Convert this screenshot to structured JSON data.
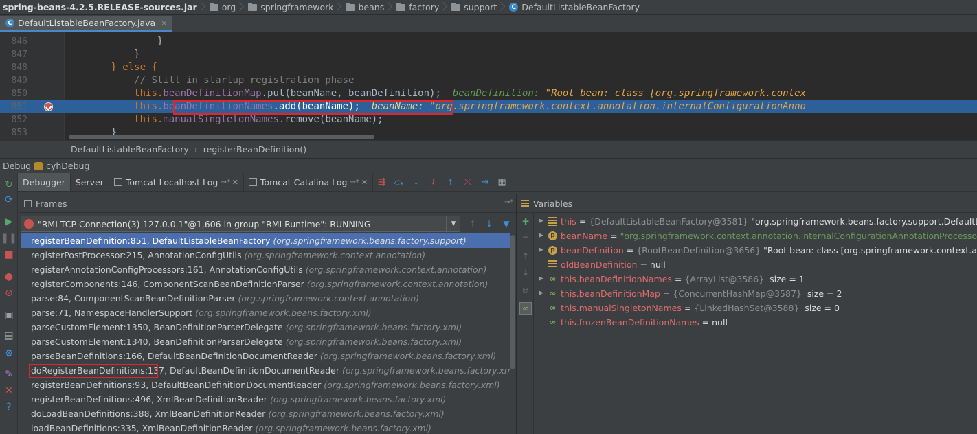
{
  "navbar": {
    "jar": "spring-beans-4.2.5.RELEASE-sources.jar",
    "folders": [
      "org",
      "springframework",
      "beans",
      "factory",
      "support"
    ],
    "class_name": "DefaultListableBeanFactory"
  },
  "tab": {
    "filename": "DefaultListableBeanFactory.java",
    "close": "×"
  },
  "editor": {
    "line_numbers": [
      "846",
      "847",
      "848",
      "849",
      "850",
      "851",
      "852",
      "853"
    ],
    "lines": [
      {
        "indent": "                ",
        "text": "}"
      },
      {
        "indent": "            ",
        "text": "}"
      },
      {
        "indent": "        ",
        "kw": "} else {"
      },
      {
        "indent": "            ",
        "comment": "// Still in startup registration phase"
      },
      {
        "indent": "            ",
        "this": "this.",
        "field": "beanDefinitionMap",
        "rest": ".put(beanName, beanDefinition);",
        "inline_name": "beanDefinition:",
        "inline_val": "\"Root bean: class [org.springframework.contex"
      },
      {
        "indent": "            ",
        "this": "this.",
        "field": "beanDefinitionNames",
        "rest": ".add(beanName);",
        "inline_name": "beanName:",
        "inline_val": "\"org.springframework.context.annotation.internalConfigurationAnno"
      },
      {
        "indent": "            ",
        "this": "this.",
        "field": "manualSingletonNames",
        "rest": ".remove(beanName);"
      },
      {
        "indent": "        ",
        "text": "}"
      }
    ]
  },
  "editor_crumbs": [
    "DefaultListableBeanFactory",
    "registerBeanDefinition()"
  ],
  "debug": {
    "title": "Debug",
    "config": "cyhDebug",
    "tabs": [
      {
        "label": "Debugger"
      },
      {
        "label": "Server"
      },
      {
        "label": "Tomcat Localhost Log"
      },
      {
        "label": "Tomcat Catalina Log"
      }
    ],
    "frames_title": "Frames",
    "variables_title": "Variables",
    "thread": "\"RMI TCP Connection(3)-127.0.0.1\"@1,606 in group \"RMI Runtime\": RUNNING",
    "frames": [
      {
        "method": "registerBeanDefinition:851, DefaultListableBeanFactory",
        "pkg": "(org.springframework.beans.factory.support)"
      },
      {
        "method": "registerPostProcessor:215, AnnotationConfigUtils",
        "pkg": "(org.springframework.context.annotation)"
      },
      {
        "method": "registerAnnotationConfigProcessors:161, AnnotationConfigUtils",
        "pkg": "(org.springframework.context.annotation)"
      },
      {
        "method": "registerComponents:146, ComponentScanBeanDefinitionParser",
        "pkg": "(org.springframework.context.annotation)"
      },
      {
        "method": "parse:84, ComponentScanBeanDefinitionParser",
        "pkg": "(org.springframework.context.annotation)"
      },
      {
        "method": "parse:71, NamespaceHandlerSupport",
        "pkg": "(org.springframework.beans.factory.xml)"
      },
      {
        "method": "parseCustomElement:1350, BeanDefinitionParserDelegate",
        "pkg": "(org.springframework.beans.factory.xml)"
      },
      {
        "method": "parseCustomElement:1340, BeanDefinitionParserDelegate",
        "pkg": "(org.springframework.beans.factory.xml)"
      },
      {
        "method": "parseBeanDefinitions:166, DefaultBeanDefinitionDocumentReader",
        "pkg": "(org.springframework.beans.factory.xml)"
      },
      {
        "method": "doRegisterBeanDefinitions:137, DefaultBeanDefinitionDocumentReader",
        "pkg": "(org.springframework.beans.factory.xml)"
      },
      {
        "method": "registerBeanDefinitions:93, DefaultBeanDefinitionDocumentReader",
        "pkg": "(org.springframework.beans.factory.xml)"
      },
      {
        "method": "registerBeanDefinitions:496, XmlBeanDefinitionReader",
        "pkg": "(org.springframework.beans.factory.xml)"
      },
      {
        "method": "doLoadBeanDefinitions:388, XmlBeanDefinitionReader",
        "pkg": "(org.springframework.beans.factory.xml)"
      },
      {
        "method": "loadBeanDefinitions:335, XmlBeanDefinitionReader",
        "pkg": "(org.springframework.beans.factory.xml)"
      }
    ],
    "variables": [
      {
        "name": "this",
        "ref": "{DefaultListableBeanFactory@3581}",
        "value": "\"org.springframework.beans.factory.support.DefaultListableBe"
      },
      {
        "name": "beanName",
        "value_str": "\"org.springframework.context.annotation.internalConfigurationAnnotationProcessor\""
      },
      {
        "name": "beanDefinition",
        "ref": "{RootBeanDefinition@3656}",
        "value": "\"Root bean: class [org.springframework.context.annotatio"
      },
      {
        "name": "oldBeanDefinition",
        "value": "null"
      },
      {
        "name": "this.beanDefinitionNames",
        "ref": "{ArrayList@3586}",
        "value": "size = 1"
      },
      {
        "name": "this.beanDefinitionMap",
        "ref": "{ConcurrentHashMap@3587}",
        "value": "size = 2"
      },
      {
        "name": "this.manualSingletonNames",
        "ref": "{LinkedHashSet@3588}",
        "value": "size = 0"
      },
      {
        "name": "this.frozenBeanDefinitionNames",
        "value": "null"
      }
    ]
  },
  "colors": {
    "selection": "#4b6eaf",
    "exec_line": "#2d6099",
    "highlight_box": "#e0262a"
  }
}
